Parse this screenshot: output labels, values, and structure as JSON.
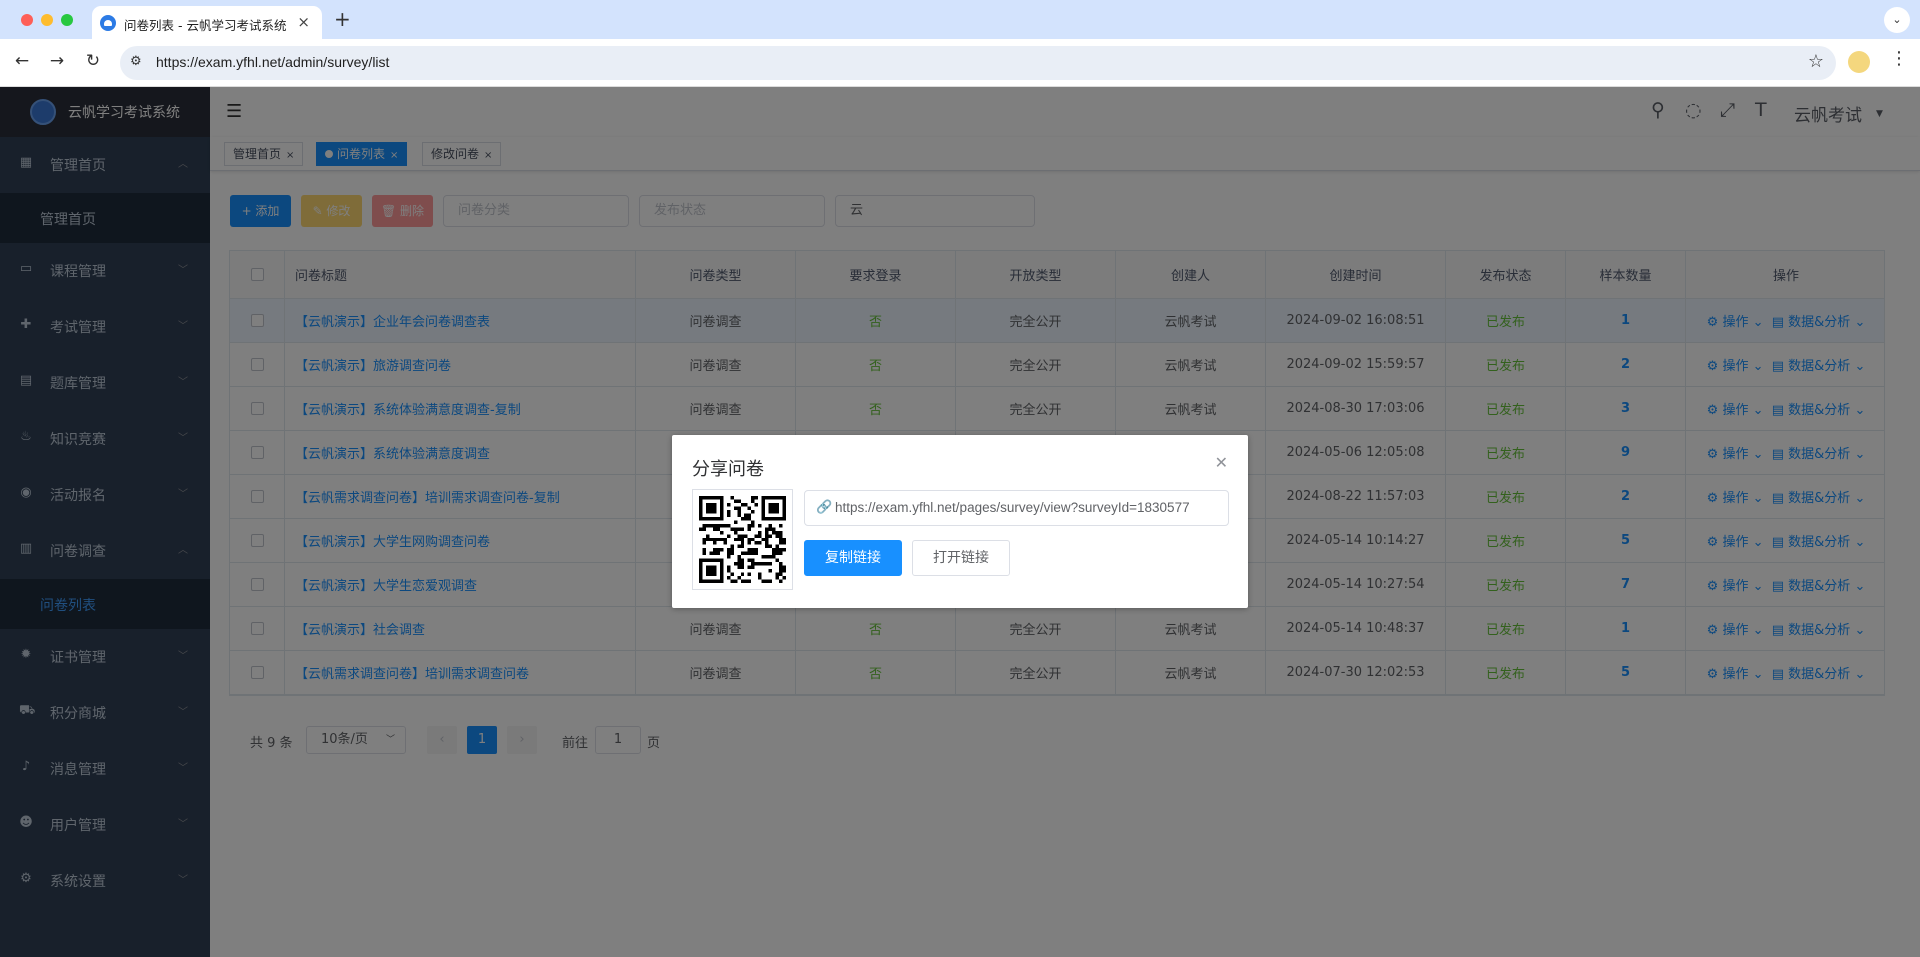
{
  "browser": {
    "tab_title": "问卷列表 - 云帆学习考试系统",
    "url": "https://exam.yfhl.net/admin/survey/list"
  },
  "sidebar": {
    "brand": "云帆学习考试系统",
    "items": [
      {
        "label": "管理首页",
        "icon": "dashboard-icon"
      },
      {
        "label": "课程管理",
        "icon": "monitor-icon"
      },
      {
        "label": "考试管理",
        "icon": "exam-icon"
      },
      {
        "label": "题库管理",
        "icon": "document-icon"
      },
      {
        "label": "知识竞赛",
        "icon": "fire-icon"
      },
      {
        "label": "活动报名",
        "icon": "target-icon"
      },
      {
        "label": "问卷调查",
        "icon": "book-icon"
      },
      {
        "label": "证书管理",
        "icon": "certificate-icon"
      },
      {
        "label": "积分商城",
        "icon": "cart-icon"
      },
      {
        "label": "消息管理",
        "icon": "bell-icon"
      },
      {
        "label": "用户管理",
        "icon": "user-icon"
      },
      {
        "label": "系统设置",
        "icon": "gear-icon"
      }
    ],
    "sub_home": "管理首页",
    "sub_survey": "问卷列表"
  },
  "navbar": {
    "user": "云帆考试"
  },
  "tags": [
    {
      "label": "管理首页"
    },
    {
      "label": "问卷列表"
    },
    {
      "label": "修改问卷"
    }
  ],
  "toolbar": {
    "add": "+ 添加",
    "edit": "✎ 修改",
    "delete": "🗑 删除",
    "category_placeholder": "问卷分类",
    "status_placeholder": "发布状态",
    "search_value": "云"
  },
  "table": {
    "headers": [
      "问卷标题",
      "问卷类型",
      "要求登录",
      "开放类型",
      "创建人",
      "创建时间",
      "发布状态",
      "样本数量",
      "操作"
    ],
    "rows": [
      {
        "title": "【云帆演示】企业年会问卷调查表",
        "type": "问卷调查",
        "login": "否",
        "open": "完全公开",
        "creator": "云帆考试",
        "time": "2024-09-02 16:08:51",
        "status": "已发布",
        "count": "1"
      },
      {
        "title": "【云帆演示】旅游调查问卷",
        "type": "问卷调查",
        "login": "否",
        "open": "完全公开",
        "creator": "云帆考试",
        "time": "2024-09-02 15:59:57",
        "status": "已发布",
        "count": "2"
      },
      {
        "title": "【云帆演示】系统体验满意度调查-复制",
        "type": "问卷调查",
        "login": "否",
        "open": "完全公开",
        "creator": "云帆考试",
        "time": "2024-08-30 17:03:06",
        "status": "已发布",
        "count": "3"
      },
      {
        "title": "【云帆演示】系统体验满意度调查",
        "type": "",
        "login": "",
        "open": "",
        "creator": "",
        "time": "2024-05-06 12:05:08",
        "status": "已发布",
        "count": "9"
      },
      {
        "title": "【云帆需求调查问卷】培训需求调查问卷-复制",
        "type": "",
        "login": "",
        "open": "",
        "creator": "",
        "time": "2024-08-22 11:57:03",
        "status": "已发布",
        "count": "2"
      },
      {
        "title": "【云帆演示】大学生网购调查问卷",
        "type": "",
        "login": "",
        "open": "",
        "creator": "",
        "time": "2024-05-14 10:14:27",
        "status": "已发布",
        "count": "5"
      },
      {
        "title": "【云帆演示】大学生恋爱观调查",
        "type": "",
        "login": "",
        "open": "",
        "creator": "",
        "time": "2024-05-14 10:27:54",
        "status": "已发布",
        "count": "7"
      },
      {
        "title": "【云帆演示】社会调查",
        "type": "问卷调查",
        "login": "否",
        "open": "完全公开",
        "creator": "云帆考试",
        "time": "2024-05-14 10:48:37",
        "status": "已发布",
        "count": "1"
      },
      {
        "title": "【云帆需求调查问卷】培训需求调查问卷",
        "type": "问卷调查",
        "login": "否",
        "open": "完全公开",
        "creator": "云帆考试",
        "time": "2024-07-30 12:02:53",
        "status": "已发布",
        "count": "5"
      }
    ],
    "op_action": "操作",
    "op_data": "数据&分析"
  },
  "pagination": {
    "total": "共 9 条",
    "page_size": "10条/页",
    "current": "1",
    "goto_label": "前往",
    "goto_value": "1",
    "goto_unit": "页"
  },
  "dialog": {
    "title": "分享问卷",
    "link": "https://exam.yfhl.net/pages/survey/view?surveyId=1830577",
    "copy": "复制链接",
    "open": "打开链接"
  }
}
